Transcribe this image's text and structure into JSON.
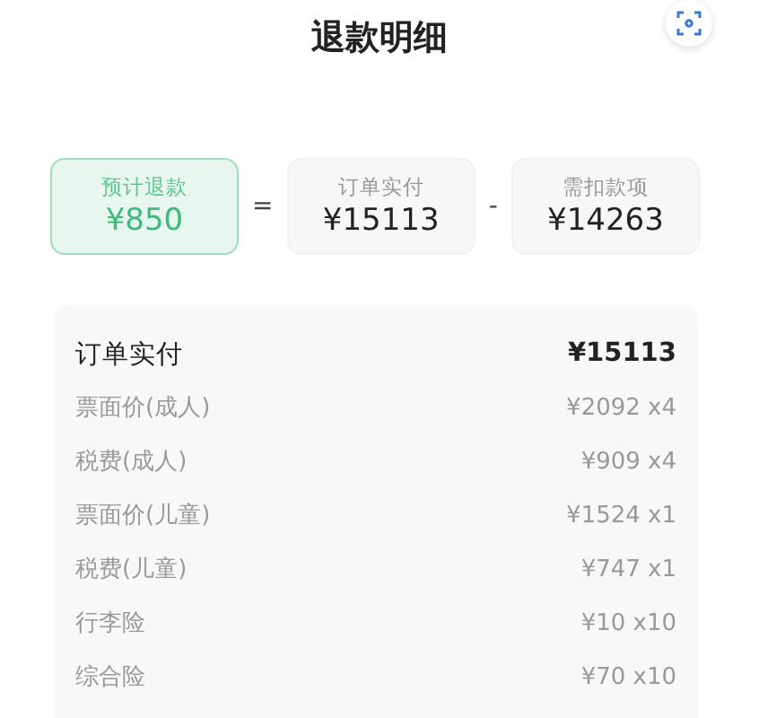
{
  "header": {
    "title": "退款明细"
  },
  "summary": [
    {
      "kind": "result",
      "label": "预计退款",
      "amount": "¥850"
    },
    {
      "kind": "operator",
      "symbol": "="
    },
    {
      "kind": "term",
      "label": "订单实付",
      "amount": "¥15113"
    },
    {
      "kind": "operator",
      "symbol": "-"
    },
    {
      "kind": "term",
      "label": "需扣款项",
      "amount": "¥14263"
    }
  ],
  "details": {
    "total": {
      "label": "订单实付",
      "amount": "¥15113"
    },
    "items": [
      {
        "label": "票面价(成人)",
        "amount": "¥2092 x4"
      },
      {
        "label": "税费(成人)",
        "amount": "¥909 x4"
      },
      {
        "label": "票面价(儿童)",
        "amount": "¥1524 x1"
      },
      {
        "label": "税费(儿童)",
        "amount": "¥747 x1"
      },
      {
        "label": "行李险",
        "amount": "¥10 x10"
      },
      {
        "label": "综合险",
        "amount": "¥70 x10"
      }
    ]
  }
}
